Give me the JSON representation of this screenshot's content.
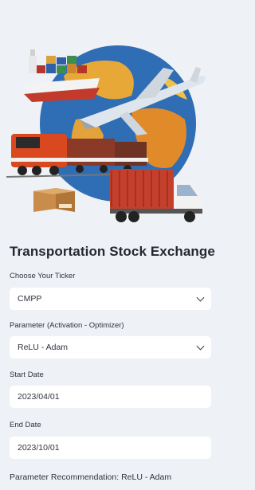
{
  "hero_image": {
    "name": "transportation-illustration"
  },
  "app": {
    "title": "Transportation Stock Exchange"
  },
  "ticker": {
    "label": "Choose Your Ticker",
    "value": "CMPP"
  },
  "parameter": {
    "label": "Parameter (Activation - Optimizer)",
    "value": "ReLU - Adam"
  },
  "start_date": {
    "label": "Start Date",
    "value": "2023/04/01"
  },
  "end_date": {
    "label": "End Date",
    "value": "2023/10/01"
  },
  "recommendation": {
    "text": "Parameter Recommendation: ReLU - Adam"
  },
  "colors": {
    "background": "#eef1f5",
    "field": "#ffffff",
    "text": "#31333f"
  }
}
